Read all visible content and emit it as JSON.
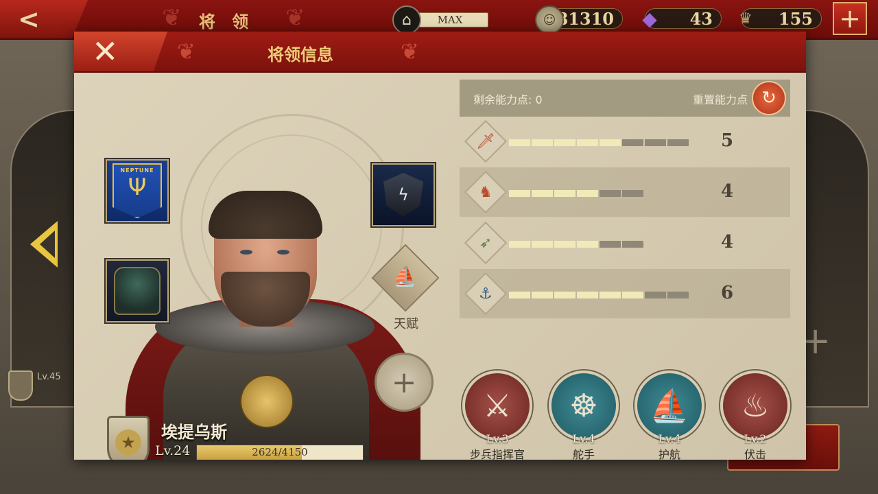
{
  "top_bar": {
    "title": "将 领",
    "building_level": "MAX",
    "coins": "81310",
    "gems": "43",
    "badges": "155",
    "icons": {
      "back": "back-arrow-icon",
      "building": "temple-icon",
      "coin": "coin-icon",
      "gem": "gem-icon",
      "badge": "spqr-icon",
      "add": "plus-icon"
    }
  },
  "modal": {
    "title": "将领信息",
    "close_icon": "close-icon"
  },
  "general": {
    "name": "埃提乌斯",
    "level": "Lv.24",
    "xp_text": "2624/4150",
    "xp_fraction": 0.632,
    "talent_label": "天赋"
  },
  "background": {
    "side_level": "Lv.45"
  },
  "stats_panel": {
    "remaining_label": "剩余能力点: 0",
    "reset_label": "重置能力点",
    "rows": [
      {
        "icon": "sword-icon",
        "value": "5",
        "filled": 5,
        "total": 8
      },
      {
        "icon": "horse-icon",
        "value": "4",
        "filled": 4,
        "total": 6
      },
      {
        "icon": "bow-icon",
        "value": "4",
        "filled": 4,
        "total": 6
      },
      {
        "icon": "anchor-icon",
        "value": "6",
        "filled": 6,
        "total": 8
      }
    ]
  },
  "skills": [
    {
      "name": "步兵指挥官",
      "level": "Lv.3",
      "icon": "crossed-swords-icon",
      "color": "#8a3a33"
    },
    {
      "name": "舵手",
      "level": "Lv.4",
      "icon": "ship-wheel-icon",
      "color": "#2f7480"
    },
    {
      "name": "护航",
      "level": "Lv.4",
      "icon": "warship-icon",
      "color": "#2f7480"
    },
    {
      "name": "伏击",
      "level": "Lv.2",
      "icon": "ambush-icon",
      "color": "#8a3a33"
    }
  ]
}
